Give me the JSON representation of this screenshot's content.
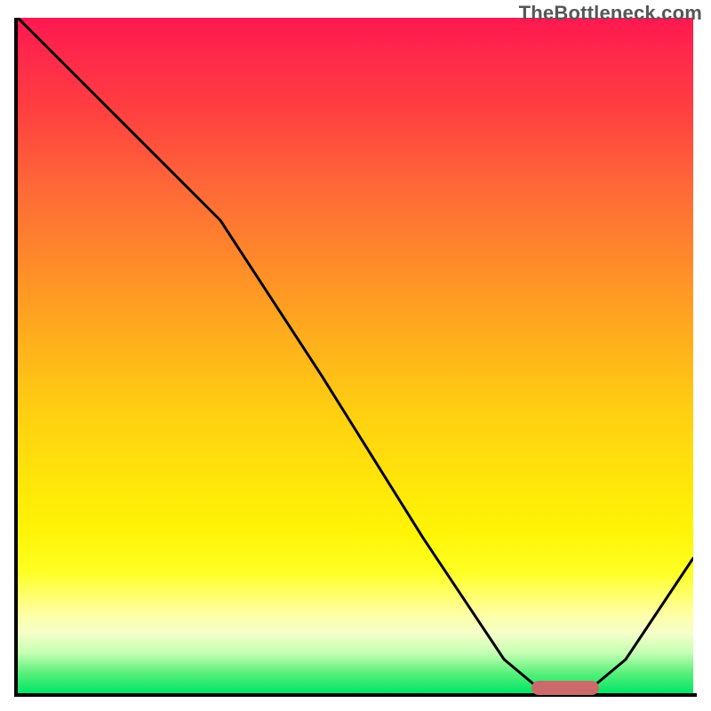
{
  "watermark": "TheBottleneck.com",
  "chart_data": {
    "type": "line",
    "title": "",
    "xlabel": "",
    "ylabel": "",
    "xlim": [
      0,
      100
    ],
    "ylim": [
      0,
      100
    ],
    "grid": false,
    "series": [
      {
        "name": "curve",
        "x": [
          0,
          10,
          22,
          30,
          45,
          60,
          72,
          78,
          84,
          90,
          100
        ],
        "values": [
          100,
          90,
          78,
          70,
          47,
          23,
          5,
          0,
          0,
          5,
          20
        ]
      }
    ],
    "marker": {
      "x_start": 76,
      "x_end": 86,
      "y": 0,
      "color": "#cc6a6b"
    },
    "gradient_stops": [
      {
        "pct": 0,
        "color": "#ff1850"
      },
      {
        "pct": 14,
        "color": "#ff4040"
      },
      {
        "pct": 36,
        "color": "#ff8a2a"
      },
      {
        "pct": 58,
        "color": "#ffce12"
      },
      {
        "pct": 82,
        "color": "#ffff24"
      },
      {
        "pct": 94,
        "color": "#c6ffb4"
      },
      {
        "pct": 100,
        "color": "#00e668"
      }
    ]
  }
}
